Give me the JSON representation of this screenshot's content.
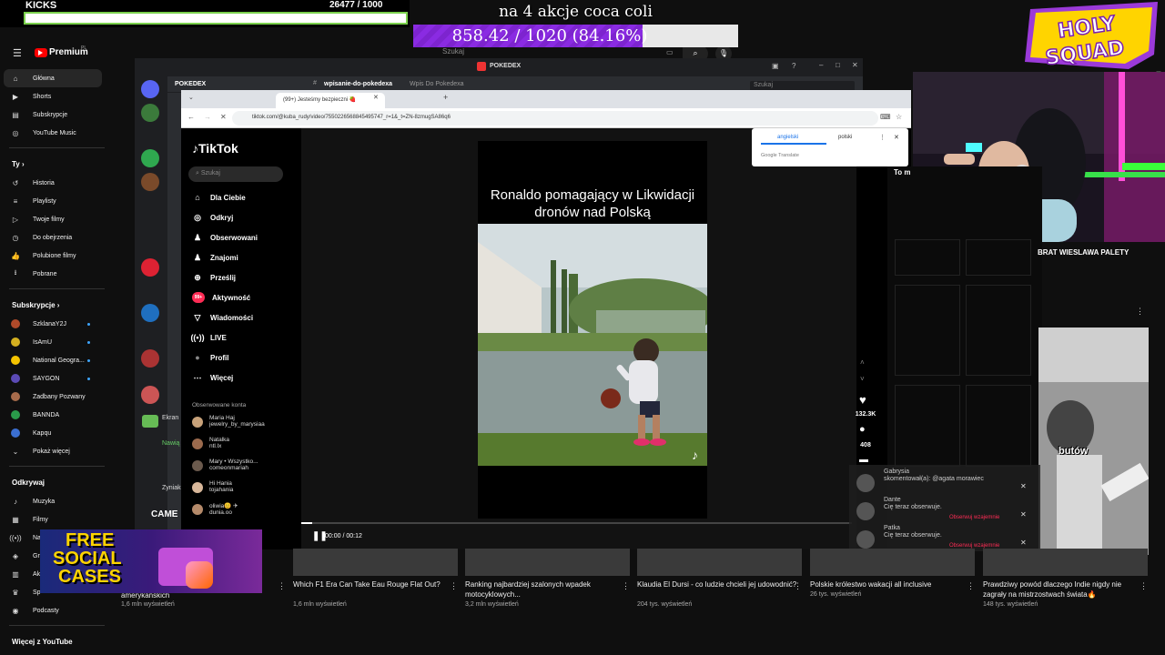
{
  "overlay": {
    "kicks_label": "KICKS",
    "kicks_count": "26477  / 1000",
    "kicks_progress": 1.0,
    "goal_title": "na 4 akcje coca coli",
    "goal_text": "858.42 / 1020 (84.16%)",
    "goal_progress": 0.8416,
    "holy_line1": "HOLY",
    "holy_line2": "SQUAD"
  },
  "youtube": {
    "logo": "Premium",
    "logo_sup": "PL",
    "search_placeholder": "Szukaj",
    "sidebar": {
      "main": [
        {
          "label": "Główna",
          "icon": "home-icon"
        },
        {
          "label": "Shorts",
          "icon": "shorts-icon"
        },
        {
          "label": "Subskrypcje",
          "icon": "subscriptions-icon"
        },
        {
          "label": "YouTube Music",
          "icon": "music-icon"
        }
      ],
      "you_header": "Ty",
      "you": [
        {
          "label": "Historia",
          "icon": "history-icon"
        },
        {
          "label": "Playlisty",
          "icon": "playlist-icon"
        },
        {
          "label": "Twoje filmy",
          "icon": "your-videos-icon"
        },
        {
          "label": "Do obejrzenia",
          "icon": "watch-later-icon"
        },
        {
          "label": "Polubione filmy",
          "icon": "like-icon"
        },
        {
          "label": "Pobrane",
          "icon": "download-icon"
        }
      ],
      "subs_header": "Subskrypcje",
      "subs": [
        {
          "label": "SzklanaY2J",
          "color": "#b04a2a"
        },
        {
          "label": "IsAmU",
          "color": "#d4b020"
        },
        {
          "label": "National Geogra...",
          "color": "#f5c400"
        },
        {
          "label": "SAYGON",
          "color": "#5b4ab5"
        },
        {
          "label": "Zadbany Pozwany",
          "color": "#a76b4b"
        },
        {
          "label": "BANNDA",
          "color": "#2a9a4a"
        },
        {
          "label": "Kapqu",
          "color": "#3b6fd1"
        }
      ],
      "show_more": "Pokaż więcej",
      "explore_header": "Odkrywaj",
      "explore": [
        {
          "label": "Muzyka",
          "icon": "music-note-icon"
        },
        {
          "label": "Filmy",
          "icon": "film-icon"
        },
        {
          "label": "Na żywo",
          "icon": "live-icon"
        },
        {
          "label": "Gr",
          "icon": "gaming-icon"
        },
        {
          "label": "Ak",
          "icon": "news-icon"
        },
        {
          "label": "Sp",
          "icon": "trophy-icon"
        },
        {
          "label": "Podcasty",
          "icon": "podcast-icon"
        }
      ],
      "more_header": "Więcej z YouTube"
    },
    "videos": [
      {
        "title": "amerykańskich",
        "meta": "1,6 mln wyświetleń"
      },
      {
        "title": "Which F1 Era Can Take Eau Rouge Flat Out?",
        "meta": "1,6 mln wyświetleń"
      },
      {
        "title": "Ranking najbardziej szalonych wpadek motocyklowych...",
        "meta": "3,2 mln wyświetleń"
      },
      {
        "title": "Klaudia El Dursi - co ludzie chcieli jej udowodnić?",
        "meta": "204 tys. wyświetleń"
      },
      {
        "title": "Polskie królestwo wakacji all inclusive",
        "meta": "26 tys. wyświetleń"
      },
      {
        "title": "Prawdziwy powód dlaczego Indie nigdy nie zagrały na mistrzostwach świata🔥",
        "meta": "148 tys. wyświetleń"
      }
    ],
    "right_title": "BRAT WIESLAWA PALETY",
    "right_partial": "To m",
    "thumb_text": "butów"
  },
  "discord": {
    "server_title": "POKEDEX",
    "channel": "wpisanie-do-pokedexa",
    "channel_sub": "Wpis Do Pokedexa",
    "search": "Szukaj",
    "window_title": "POKEDEX",
    "left_partial_1": "Ekran",
    "left_partial_2": "Nawią",
    "left_partial_3": "Zyniak",
    "left_partial_4": "CAME"
  },
  "chrome": {
    "tab_title": "(99+) Jesteśmy bezpieczni 🍓",
    "url": "tiktok.com/@kuba_rudy/video/7550226568845495747_r=1&_t=ZN-8zmugSA86q6"
  },
  "translate": {
    "lang_from": "angielski",
    "lang_to": "polski",
    "brand": "Google Translate"
  },
  "tiktok": {
    "logo": "TikTok",
    "search_placeholder": "Szukaj",
    "nav": [
      {
        "label": "Dla Ciebie",
        "icon": "home-icon"
      },
      {
        "label": "Odkryj",
        "icon": "compass-icon"
      },
      {
        "label": "Obserwowani",
        "icon": "following-icon"
      },
      {
        "label": "Znajomi",
        "icon": "friends-icon"
      },
      {
        "label": "Prześlij",
        "icon": "upload-icon"
      },
      {
        "label": "Aktywność",
        "icon": "inbox-icon"
      },
      {
        "label": "Wiadomości",
        "icon": "messages-icon"
      },
      {
        "label": "LIVE",
        "icon": "live-icon"
      },
      {
        "label": "Profil",
        "icon": "profile-icon"
      },
      {
        "label": "Więcej",
        "icon": "more-icon"
      }
    ],
    "activity_badge": "99+",
    "followed_header": "Obserwowane konta",
    "followed": [
      {
        "name": "Maria Haj",
        "handle": "jewelry_by_marysiaa",
        "color": "#c8a27a"
      },
      {
        "name": "Natalka",
        "handle": "ntl.lx",
        "color": "#9b6a4d"
      },
      {
        "name": "Mary • Wszystko...",
        "handle": "comeonmariah",
        "color": "#6b5a4d"
      },
      {
        "name": "Hi Hania",
        "handle": "tojahania",
        "color": "#d8b79a"
      },
      {
        "name": "oliwia😊 ✈",
        "handle": "dunia.oo",
        "color": "#b58a6a"
      }
    ],
    "video_caption": "Ronaldo pomagający w Likwidacji dronów nad Polską",
    "likes": "132.3K",
    "comments": "408",
    "time": "00:00 / 00:12",
    "progress": 0.02
  },
  "notifications": [
    {
      "name": "Gabrysia",
      "text": "skomentował(a): @agata morawiec"
    },
    {
      "name": "Dante",
      "text": "Cię teraz obserwuje."
    },
    {
      "name": "Patka",
      "text": "Cię teraz obserwuje."
    }
  ],
  "notif_action": "Obserwuj wzajemnie",
  "promo": {
    "line1": "FREE",
    "line2": "SOCIAL",
    "line3": "CASES"
  }
}
